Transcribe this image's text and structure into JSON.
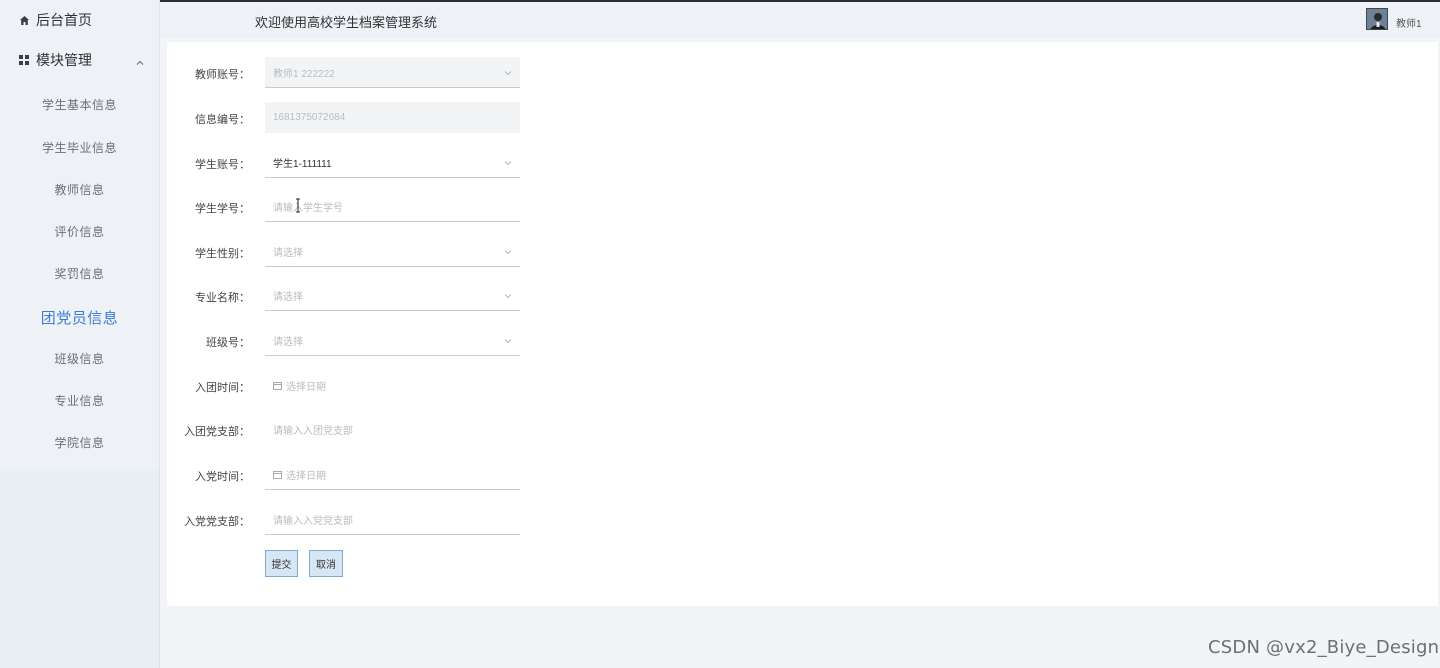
{
  "header": {
    "title": "欢迎使用高校学生档案管理系统",
    "user_name": "教师1"
  },
  "sidebar": {
    "home_label": "后台首页",
    "module_label": "模块管理",
    "items": [
      {
        "label": "学生基本信息"
      },
      {
        "label": "学生毕业信息"
      },
      {
        "label": "教师信息"
      },
      {
        "label": "评价信息"
      },
      {
        "label": "奖罚信息"
      },
      {
        "label": "团党员信息",
        "active": true
      },
      {
        "label": "班级信息"
      },
      {
        "label": "专业信息"
      },
      {
        "label": "学院信息"
      }
    ]
  },
  "form": {
    "fields": [
      {
        "label": "教师账号：",
        "value": "教师1 222222",
        "type": "select",
        "disabled": true
      },
      {
        "label": "信息编号：",
        "value": "1681375072684",
        "type": "text",
        "disabled": true
      },
      {
        "label": "学生账号：",
        "value": "学生1-111111",
        "type": "select"
      },
      {
        "label": "学生学号：",
        "placeholder": "请输入学生学号",
        "type": "text"
      },
      {
        "label": "学生性别：",
        "placeholder": "请选择",
        "type": "select"
      },
      {
        "label": "专业名称：",
        "placeholder": "请选择",
        "type": "select"
      },
      {
        "label": "班级号：",
        "placeholder": "请选择",
        "type": "select"
      },
      {
        "label": "入团时间：",
        "placeholder": "选择日期",
        "type": "date"
      },
      {
        "label": "入团党支部：",
        "placeholder": "请输入入团党支部",
        "type": "text"
      },
      {
        "label": "入党时间：",
        "placeholder": "选择日期",
        "type": "date"
      },
      {
        "label": "入党党支部：",
        "placeholder": "请输入入党党支部",
        "type": "text"
      }
    ],
    "submit_label": "提交",
    "cancel_label": "取消"
  },
  "watermark": "CSDN @vx2_Biye_Design"
}
